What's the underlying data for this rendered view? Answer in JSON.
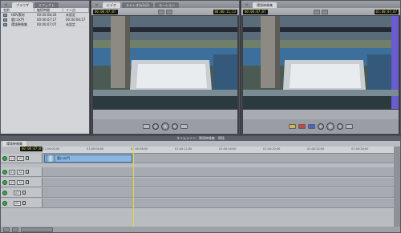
{
  "browser": {
    "tabs": [
      "ブラウザ",
      "エフェクト"
    ],
    "columns": [
      "名前",
      "継続時間",
      "イン点"
    ],
    "rows": [
      {
        "name": "HDV素材",
        "duration": "00:00:08;26",
        "in": "未設定"
      },
      {
        "name": "鹿口水門",
        "duration": "00:00:07;17",
        "in": "00:00:04;17"
      },
      {
        "name": "環境映像集",
        "duration": "00:00:07;07",
        "in": "未設定"
      }
    ]
  },
  "viewer_left": {
    "tabs": [
      "ビデオ",
      "ステレオ(a1a2)",
      "モーション"
    ],
    "timecode_duration": "00:00:07;07",
    "timecode_current": "00:00:11;23"
  },
  "viewer_right": {
    "tabs": [
      "環境映像集"
    ],
    "timecode_duration": "00:00:07;07",
    "timecode_current": "01:00:07;07"
  },
  "timeline": {
    "title": "タイムライン：環境映像集 - 環境",
    "tabs": [
      "環境映像集"
    ],
    "timecode": "00:00:07;07",
    "ruler_labels": [
      "01:00:00;00",
      "01:00:04;00",
      "01:00:08;00",
      "01:00:12;00",
      "01:00:16;00",
      "01:00:20;00",
      "01:00:24;00",
      "01:00:28;00"
    ],
    "tracks": [
      {
        "source": "v1",
        "target": "V1"
      },
      {
        "source": "a1",
        "target": "A1"
      },
      {
        "source": "a2",
        "target": "A2"
      },
      {
        "source": "",
        "target": "A3"
      },
      {
        "source": "",
        "target": "A4"
      }
    ],
    "clip_name": "鹿口水門"
  }
}
